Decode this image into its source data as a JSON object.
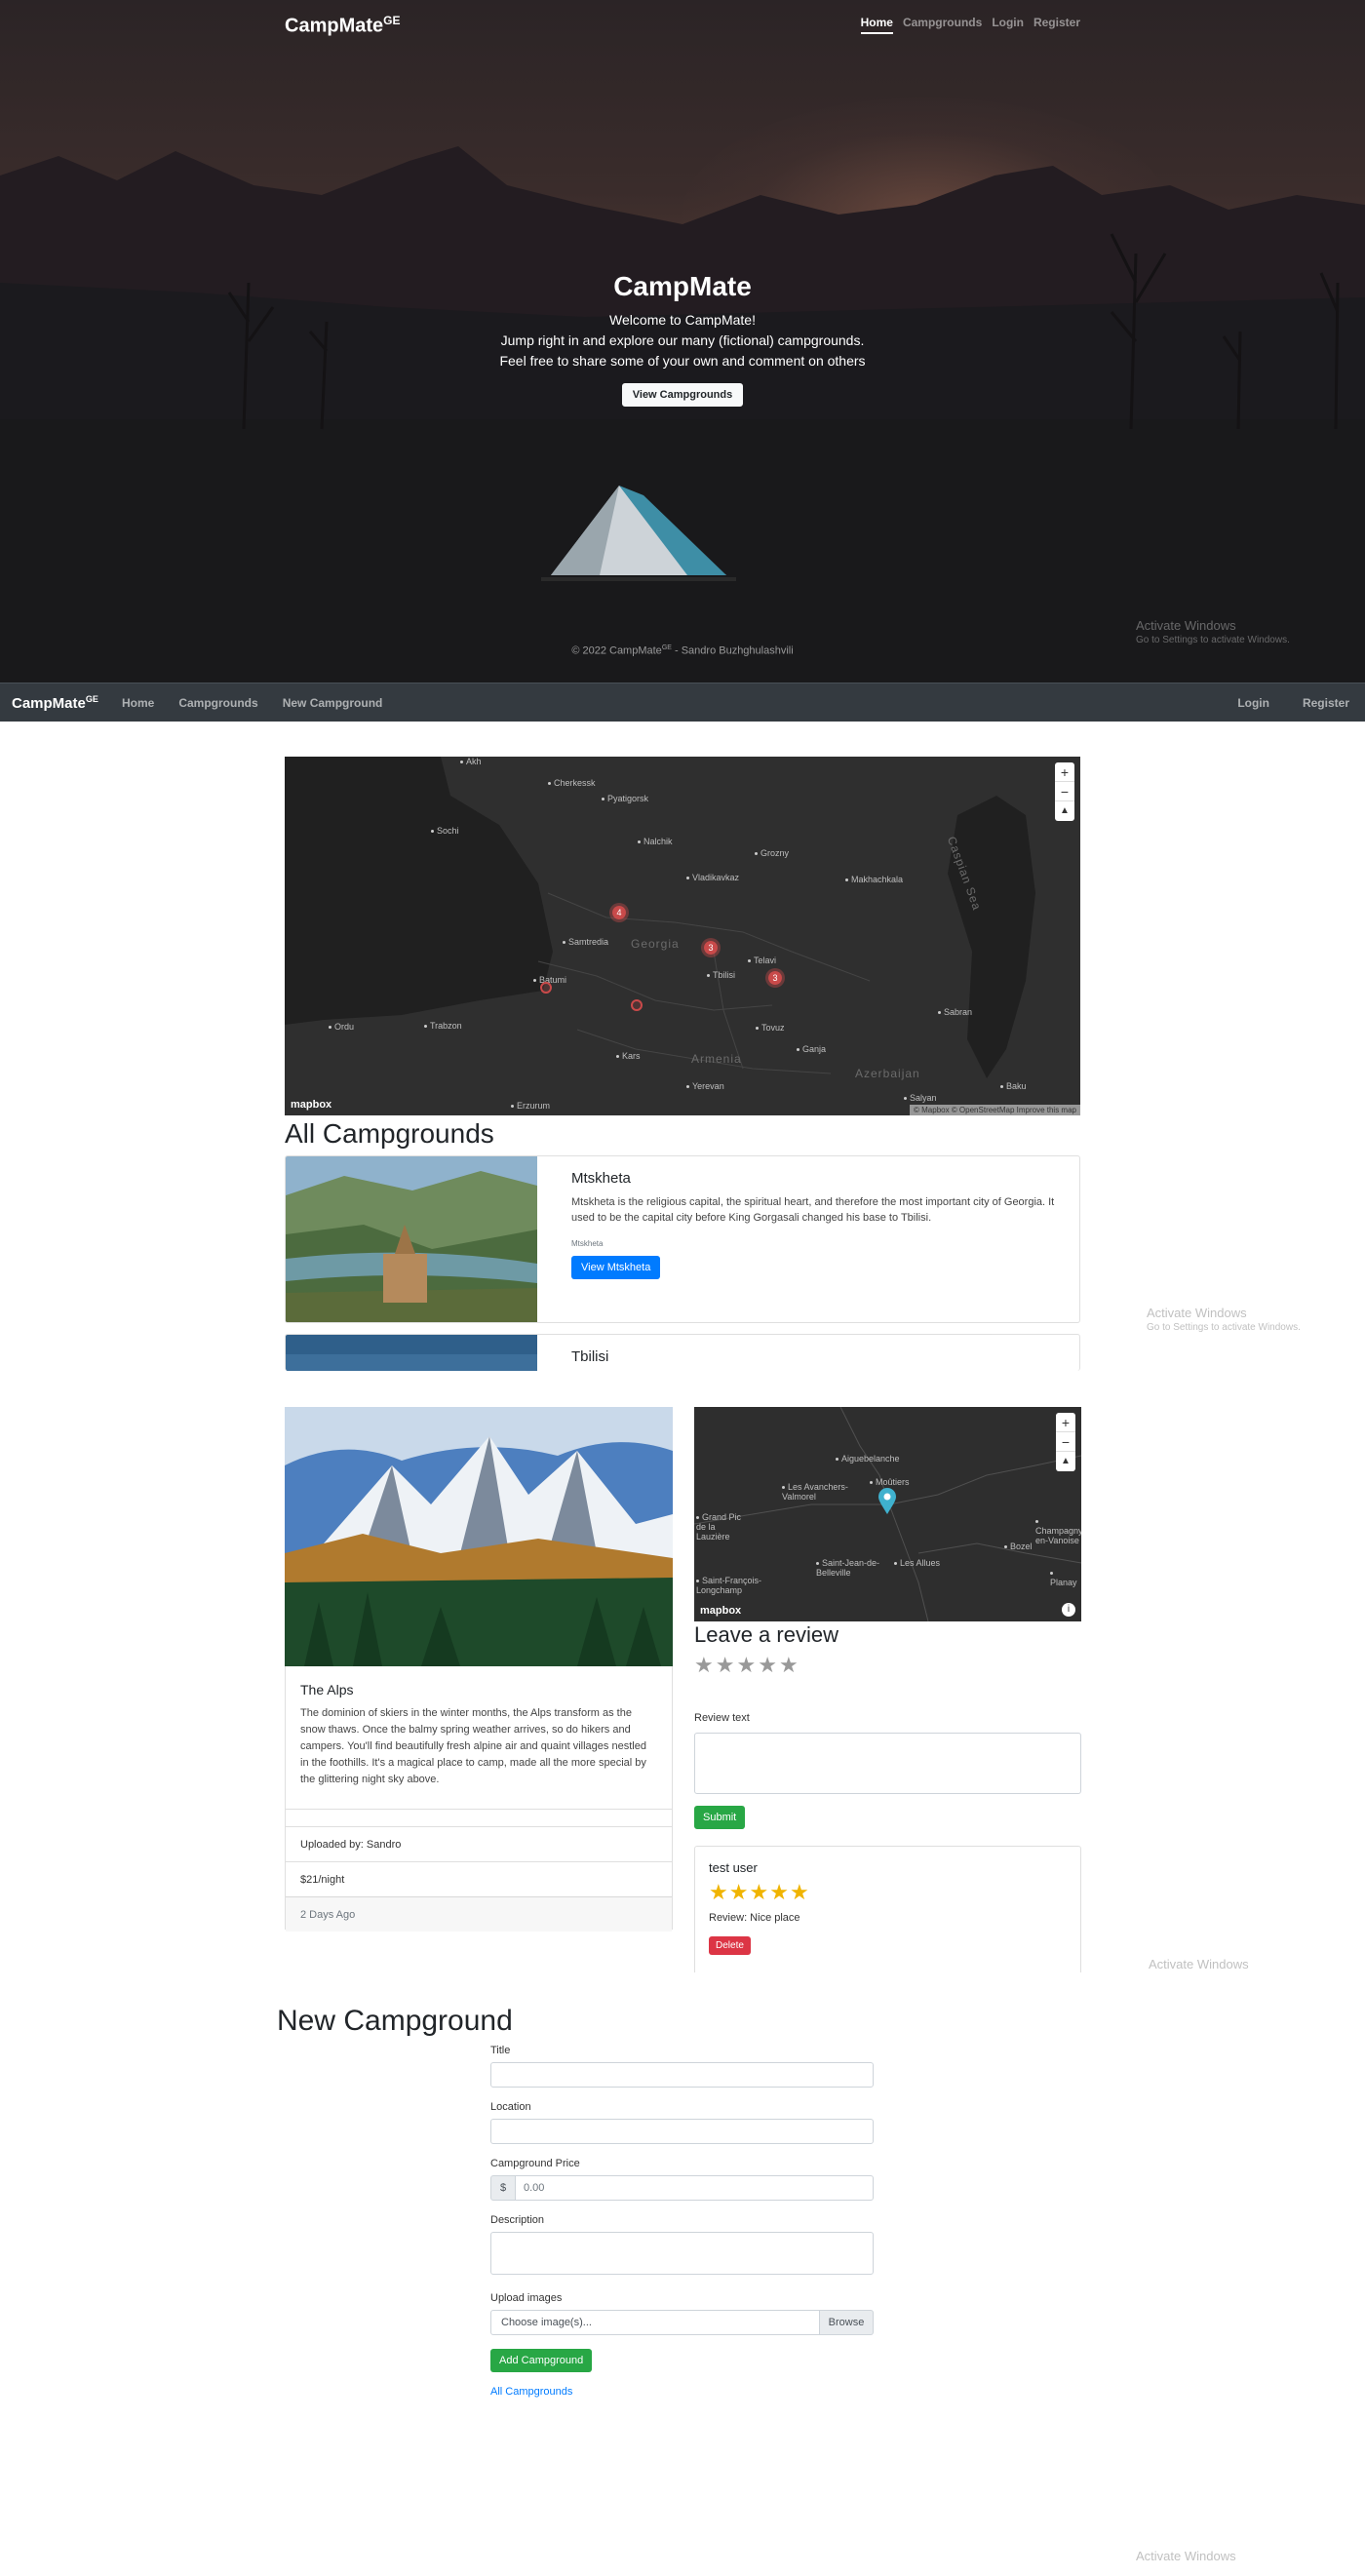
{
  "hero": {
    "brand": "CampMate",
    "brand_sup": "GE",
    "nav": [
      "Home",
      "Campgrounds",
      "Login",
      "Register"
    ],
    "title": "CampMate",
    "lines": [
      "Welcome to CampMate!",
      "Jump right in and explore our many (fictional) campgrounds.",
      "Feel free to share some of your own and comment on others"
    ],
    "button": "View Campgrounds",
    "footer_pre": "© 2022 CampMate",
    "footer_sup": "GE",
    "footer_post": " - Sandro Buzhghulashvili"
  },
  "watermark": {
    "title": "Activate Windows",
    "sub": "Go to Settings to activate Windows."
  },
  "navbar": {
    "brand": "CampMate",
    "brand_sup": "GE",
    "links": [
      "Home",
      "Campgrounds",
      "New Campground"
    ],
    "right": [
      "Login",
      "Register"
    ]
  },
  "map1": {
    "cities": [
      "Cherkessk",
      "Pyatigorsk",
      "Sochi",
      "Nalchik",
      "Grozny",
      "Vladikavkaz",
      "Makhachkala",
      "Samtredia",
      "Batumi",
      "Telavi",
      "Tbilisi",
      "Ordu",
      "Trabzon",
      "Tovuz",
      "Ganja",
      "Kars",
      "Yerevan",
      "Sabran",
      "Baku",
      "Erzurum",
      "Salyan",
      "Akh"
    ],
    "countries": [
      "Georgia",
      "Armenia",
      "Azerbaijan",
      "Caspian Sea"
    ],
    "clusters": [
      "4",
      "3",
      "3"
    ],
    "logo": "mapbox",
    "attribution": "© Mapbox © OpenStreetMap  Improve this map"
  },
  "list": {
    "title": "All Campgrounds",
    "items": [
      {
        "title": "Mtskheta",
        "description": "Mtskheta is the religious capital, the spiritual heart, and therefore the most important city of Georgia. It used to be the capital city before King Gorgasali changed his base to Tbilisi.",
        "location": "Mtskheta",
        "button": "View Mtskheta"
      },
      {
        "title": "Tbilisi"
      }
    ]
  },
  "show": {
    "title": "The Alps",
    "description": "The dominion of skiers in the winter months, the Alps transform as the snow thaws. Once the balmy spring weather arrives, so do hikers and campers. You'll find beautifully fresh alpine air and quaint villages nestled in the foothills. It's a magical place to camp, made all the more special by the glittering night sky above.",
    "uploaded": "Uploaded by: Sandro",
    "price": "$21/night",
    "age": "2 Days Ago",
    "map": {
      "places": [
        "Aiguebelanche",
        "Les Avanchers-Valmorel",
        "Moûtiers",
        "Grand Pic de la Lauzière",
        "Bozel",
        "Champagny-en-Vanoise",
        "Saint-Jean-de-Belleville",
        "Les Allues",
        "Saint-François-Longchamp",
        "Planay"
      ],
      "logo": "mapbox"
    }
  },
  "review": {
    "title": "Leave a review",
    "text_label": "Review text",
    "submit": "Submit",
    "existing": {
      "user": "test user",
      "rating": 5,
      "text": "Review: Nice place",
      "delete": "Delete"
    }
  },
  "new_campground": {
    "title": "New Campground",
    "labels": {
      "title": "Title",
      "location": "Location",
      "price": "Campground Price",
      "description": "Description",
      "images": "Upload images"
    },
    "price_prefix": "$",
    "price_placeholder": "0.00",
    "file_placeholder": "Choose image(s)...",
    "browse": "Browse",
    "submit": "Add Campground",
    "back_link": "All Campgrounds"
  }
}
